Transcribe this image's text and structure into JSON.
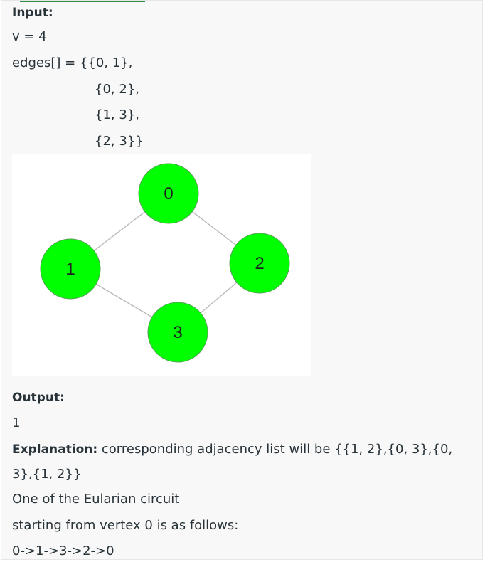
{
  "input": {
    "label": "Input:",
    "v_line": "v  =  4",
    "edges_lines": [
      "edges[]  =  {{0,  1},",
      "{0,  2},",
      "{1,  3},",
      "{2,  3}}"
    ]
  },
  "graph": {
    "nodes": [
      {
        "id": "0",
        "label": "0"
      },
      {
        "id": "1",
        "label": "1"
      },
      {
        "id": "2",
        "label": "2"
      },
      {
        "id": "3",
        "label": "3"
      }
    ],
    "edges": [
      [
        "0",
        "1"
      ],
      [
        "0",
        "2"
      ],
      [
        "1",
        "3"
      ],
      [
        "2",
        "3"
      ]
    ],
    "node_color": "#00ff00",
    "edge_color": "#b8b8b8"
  },
  "output": {
    "label": "Output:",
    "value": "1"
  },
  "explanation": {
    "label": "Explanation:",
    "text_part1": "corresponding  adjacency  list  will  be  {{1,  2},{0,  3},{0,",
    "text_part2": "3},{1,  2}}",
    "line3": "One  of  the  Eularian  circuit",
    "line4": "starting  from  vertex  0  is  as  follows:",
    "line5": "0->1->3->2->0"
  }
}
